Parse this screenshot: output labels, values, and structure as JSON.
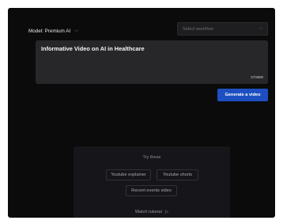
{
  "model": {
    "label": "Model: Premium AI",
    "chevron": "chevron-down-icon"
  },
  "workflow": {
    "placeholder": "Select workflow",
    "chevron": "chevron-down-icon"
  },
  "prompt": {
    "text": "Informative Video on AI in Healthcare",
    "char_count": "37/3600"
  },
  "actions": {
    "generate_label": "Generate a video",
    "accent_color": "#1d4fc1"
  },
  "suggestions": {
    "title": "Try these",
    "chips": [
      "Youtube explainer",
      "Youtube shorts",
      "Recent events video"
    ],
    "tutorial_label": "Watch tutorial",
    "tutorial_icon": "play-icon"
  }
}
